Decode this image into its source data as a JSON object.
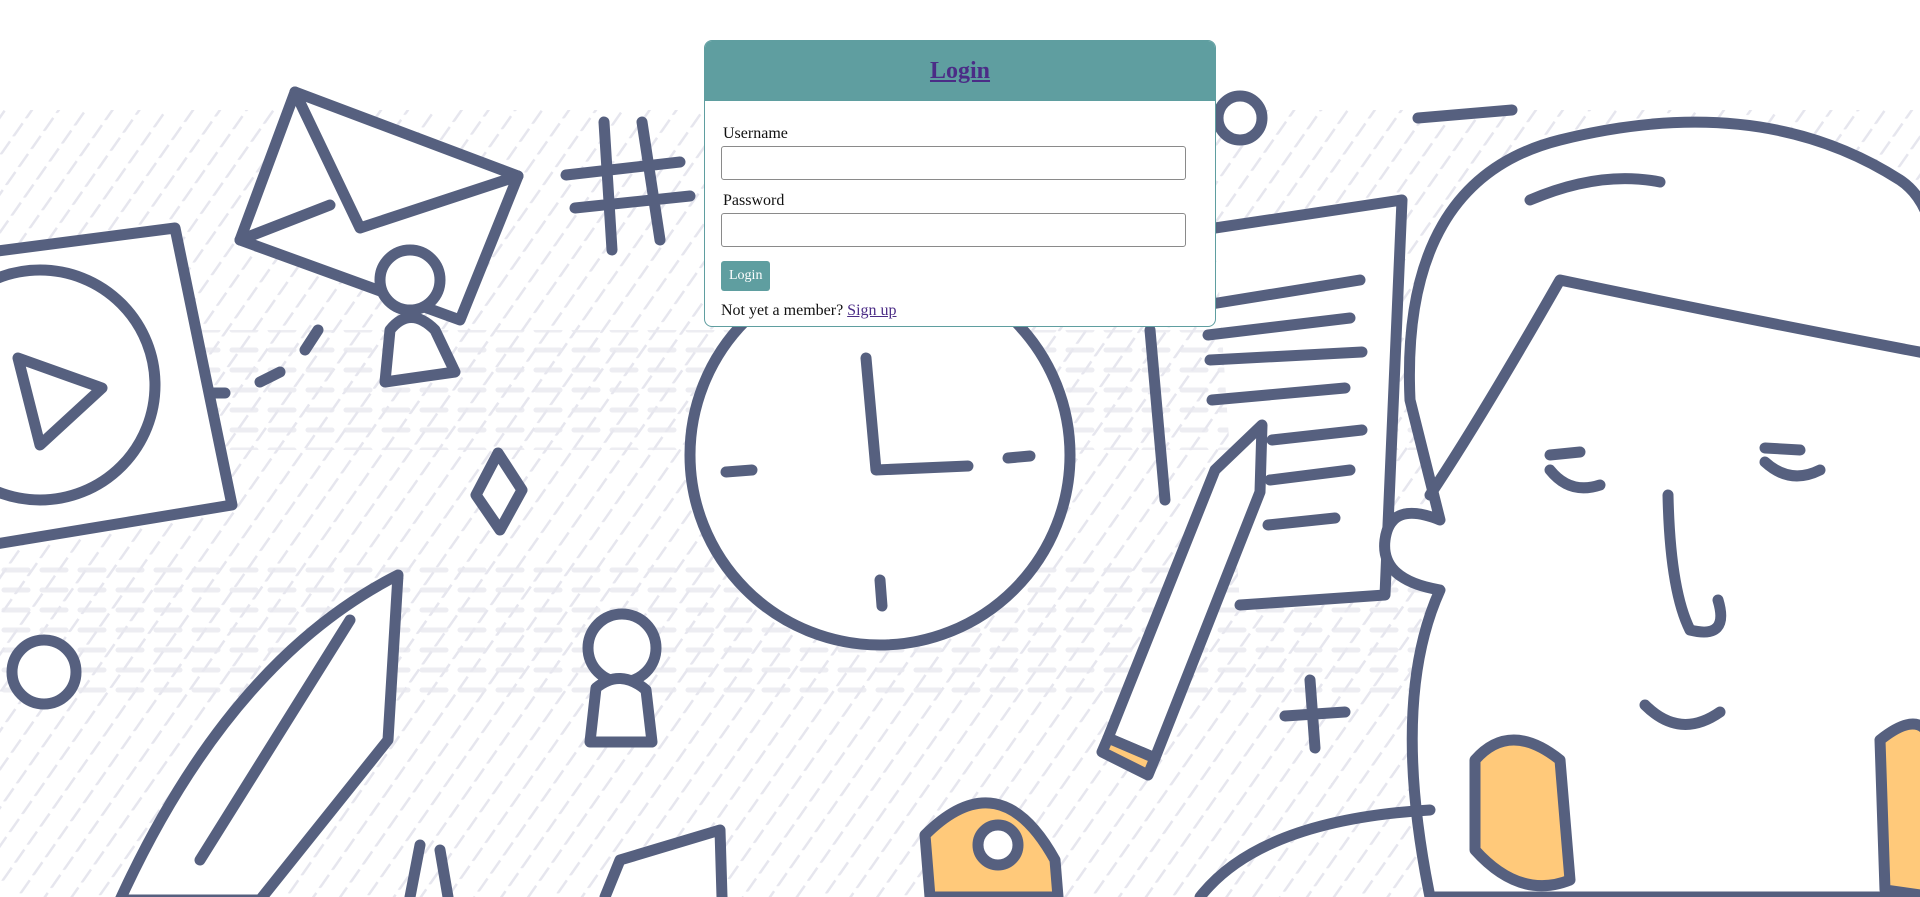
{
  "card": {
    "title": "Login",
    "username_label": "Username",
    "username_value": "",
    "password_label": "Password",
    "password_value": "",
    "login_button": "Login",
    "member_prompt": "Not yet a member?",
    "signup_link": "Sign up"
  },
  "colors": {
    "header_bg": "#5f9ea0",
    "link": "#4b2c86",
    "doodle_stroke": "#56607f",
    "doodle_shadow": "#dcdce4",
    "doodle_accent": "#ffc97a"
  },
  "background": {
    "style": "hand-drawn doodle illustration",
    "icons": [
      "play-icon",
      "envelope-icon",
      "hash-icon",
      "person-icon",
      "clock-icon",
      "document-icon",
      "pencil-icon",
      "person-face-icon",
      "plus-icon",
      "diamond-icon"
    ]
  }
}
